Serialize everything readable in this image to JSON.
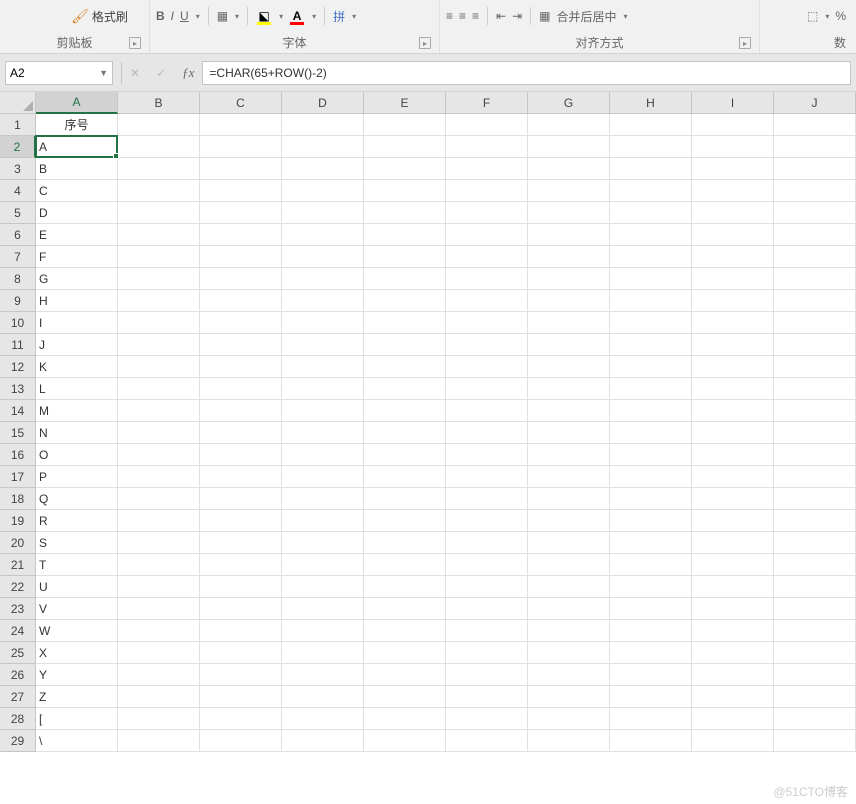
{
  "ribbon": {
    "format_painter_label": "格式刷",
    "clipboard_label": "剪贴板",
    "font_label": "字体",
    "alignment_label": "对齐方式",
    "number_hint": "数",
    "merge_label": "合并后居中",
    "percent": "%",
    "bold": "B",
    "underline": "U",
    "font_A": "A"
  },
  "namebox": {
    "cell_ref": "A2"
  },
  "formula": {
    "value": "=CHAR(65+ROW()-2)"
  },
  "columns": [
    "A",
    "B",
    "C",
    "D",
    "E",
    "F",
    "G",
    "H",
    "I",
    "J"
  ],
  "rows": [
    "1",
    "2",
    "3",
    "4",
    "5",
    "6",
    "7",
    "8",
    "9",
    "10",
    "11",
    "12",
    "13",
    "14",
    "15",
    "16",
    "17",
    "18",
    "19",
    "20",
    "21",
    "22",
    "23",
    "24",
    "25",
    "26",
    "27",
    "28",
    "29"
  ],
  "header_cell": "序号",
  "data_colA": [
    "A",
    "B",
    "C",
    "D",
    "E",
    "F",
    "G",
    "H",
    "I",
    "J",
    "K",
    "L",
    "M",
    "N",
    "O",
    "P",
    "Q",
    "R",
    "S",
    "T",
    "U",
    "V",
    "W",
    "X",
    "Y",
    "Z",
    "[",
    "\\"
  ],
  "active": {
    "row_index": 1,
    "col_index": 0
  },
  "watermark": "@51CTO博客"
}
